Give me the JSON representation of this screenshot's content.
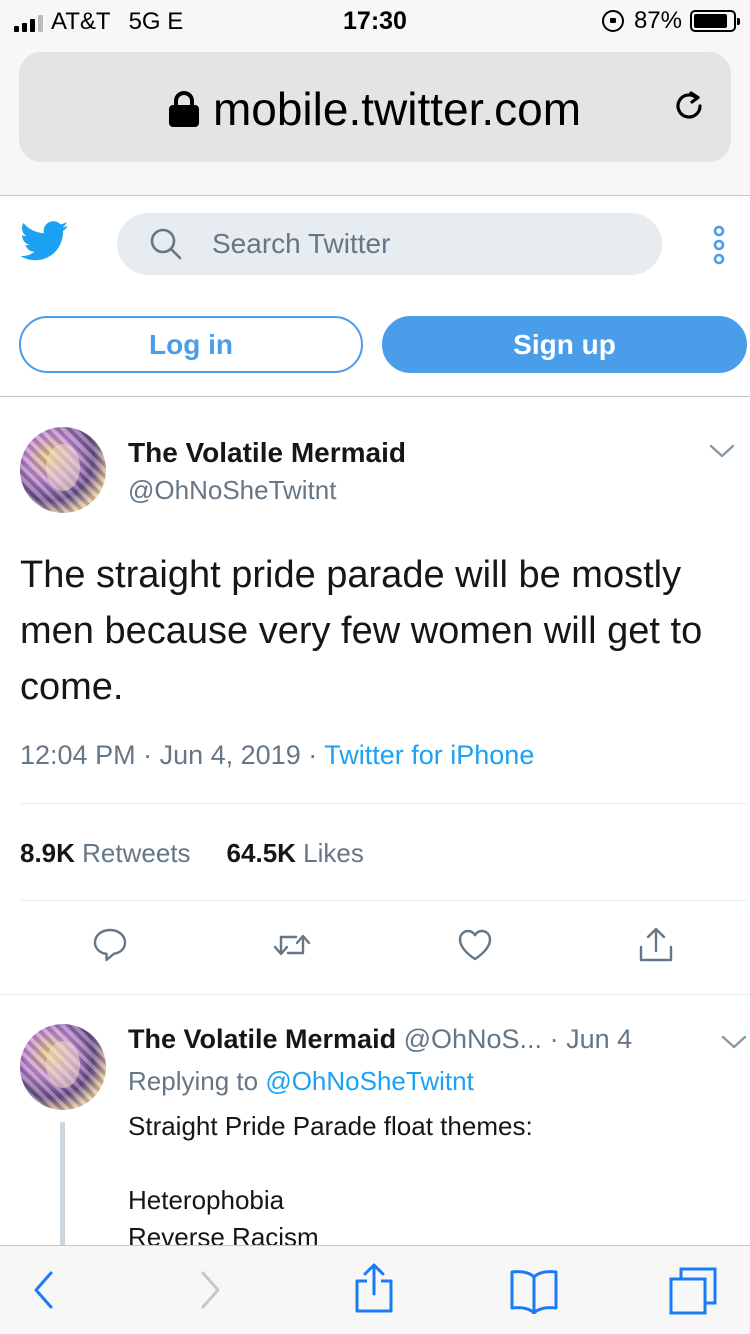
{
  "status_bar": {
    "carrier": "AT&T",
    "network": "5G E",
    "time": "17:30",
    "battery": "87%",
    "battery_level": 0.87
  },
  "browser": {
    "url": "mobile.twitter.com"
  },
  "twitter_header": {
    "search_placeholder": "Search Twitter",
    "login_label": "Log in",
    "signup_label": "Sign up",
    "accent_color": "#4a9de9"
  },
  "main_tweet": {
    "display_name": "The Volatile Mermaid",
    "handle": "@OhNoSheTwitnt",
    "text": "The straight pride parade will be mostly men because very few women will get to come.",
    "time": "12:04 PM",
    "date": "Jun 4, 2019",
    "source": "Twitter for iPhone",
    "retweets_count": "8.9K",
    "retweets_label": "Retweets",
    "likes_count": "64.5K",
    "likes_label": "Likes"
  },
  "reply_tweet": {
    "display_name": "The Volatile Mermaid",
    "handle": "@OhNoS...",
    "date": "Jun 4",
    "replying_label": "Replying to",
    "replying_to": "@OhNoSheTwitnt",
    "lines": [
      "Straight Pride Parade float themes:",
      "Heterophobia",
      "Reverse Racism"
    ]
  },
  "icons": {
    "lock": "lock-icon",
    "reload": "reload-icon",
    "bird": "twitter-bird-icon",
    "search": "search-icon",
    "more": "more-vertical-icon",
    "reply": "reply-icon",
    "retweet": "retweet-icon",
    "like": "heart-icon",
    "share": "share-icon",
    "back": "back-arrow-icon",
    "forward": "forward-arrow-icon",
    "bookmarks": "bookmarks-icon",
    "tabs": "tabs-icon"
  }
}
